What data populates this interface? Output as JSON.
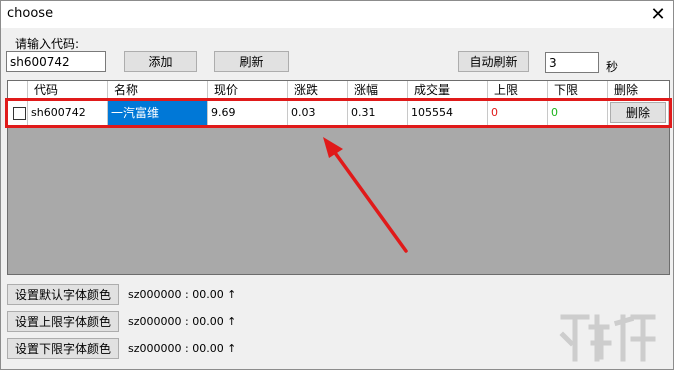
{
  "window": {
    "title": "choose",
    "close_glyph": "✕"
  },
  "form": {
    "code_label": "请输入代码:",
    "code_value": "sh600742",
    "add_button": "添加",
    "refresh_button": "刷新",
    "auto_refresh_button": "自动刷新",
    "interval_value": "3",
    "interval_unit": "秒"
  },
  "grid": {
    "columns": [
      "代码",
      "名称",
      "现价",
      "涨跌",
      "涨幅",
      "成交量",
      "上限",
      "下限",
      "删除"
    ],
    "rows": [
      {
        "code": "sh600742",
        "name": "一汽富维",
        "price": "9.69",
        "change": "0.03",
        "change_pct": "0.31",
        "volume": "105554",
        "upper": "0",
        "lower": "0",
        "delete_label": "删除"
      }
    ]
  },
  "footer": {
    "default_color_button": "设置默认字体颜色",
    "upper_color_button": "设置上限字体颜色",
    "lower_color_button": "设置下限字体颜色",
    "sample_text": "sz000000 : 00.00 ↑"
  },
  "colors": {
    "upper_limit": "#e01a1a",
    "lower_limit": "#1db31d",
    "selection": "#0078d7",
    "highlight": "#e01a1a"
  }
}
